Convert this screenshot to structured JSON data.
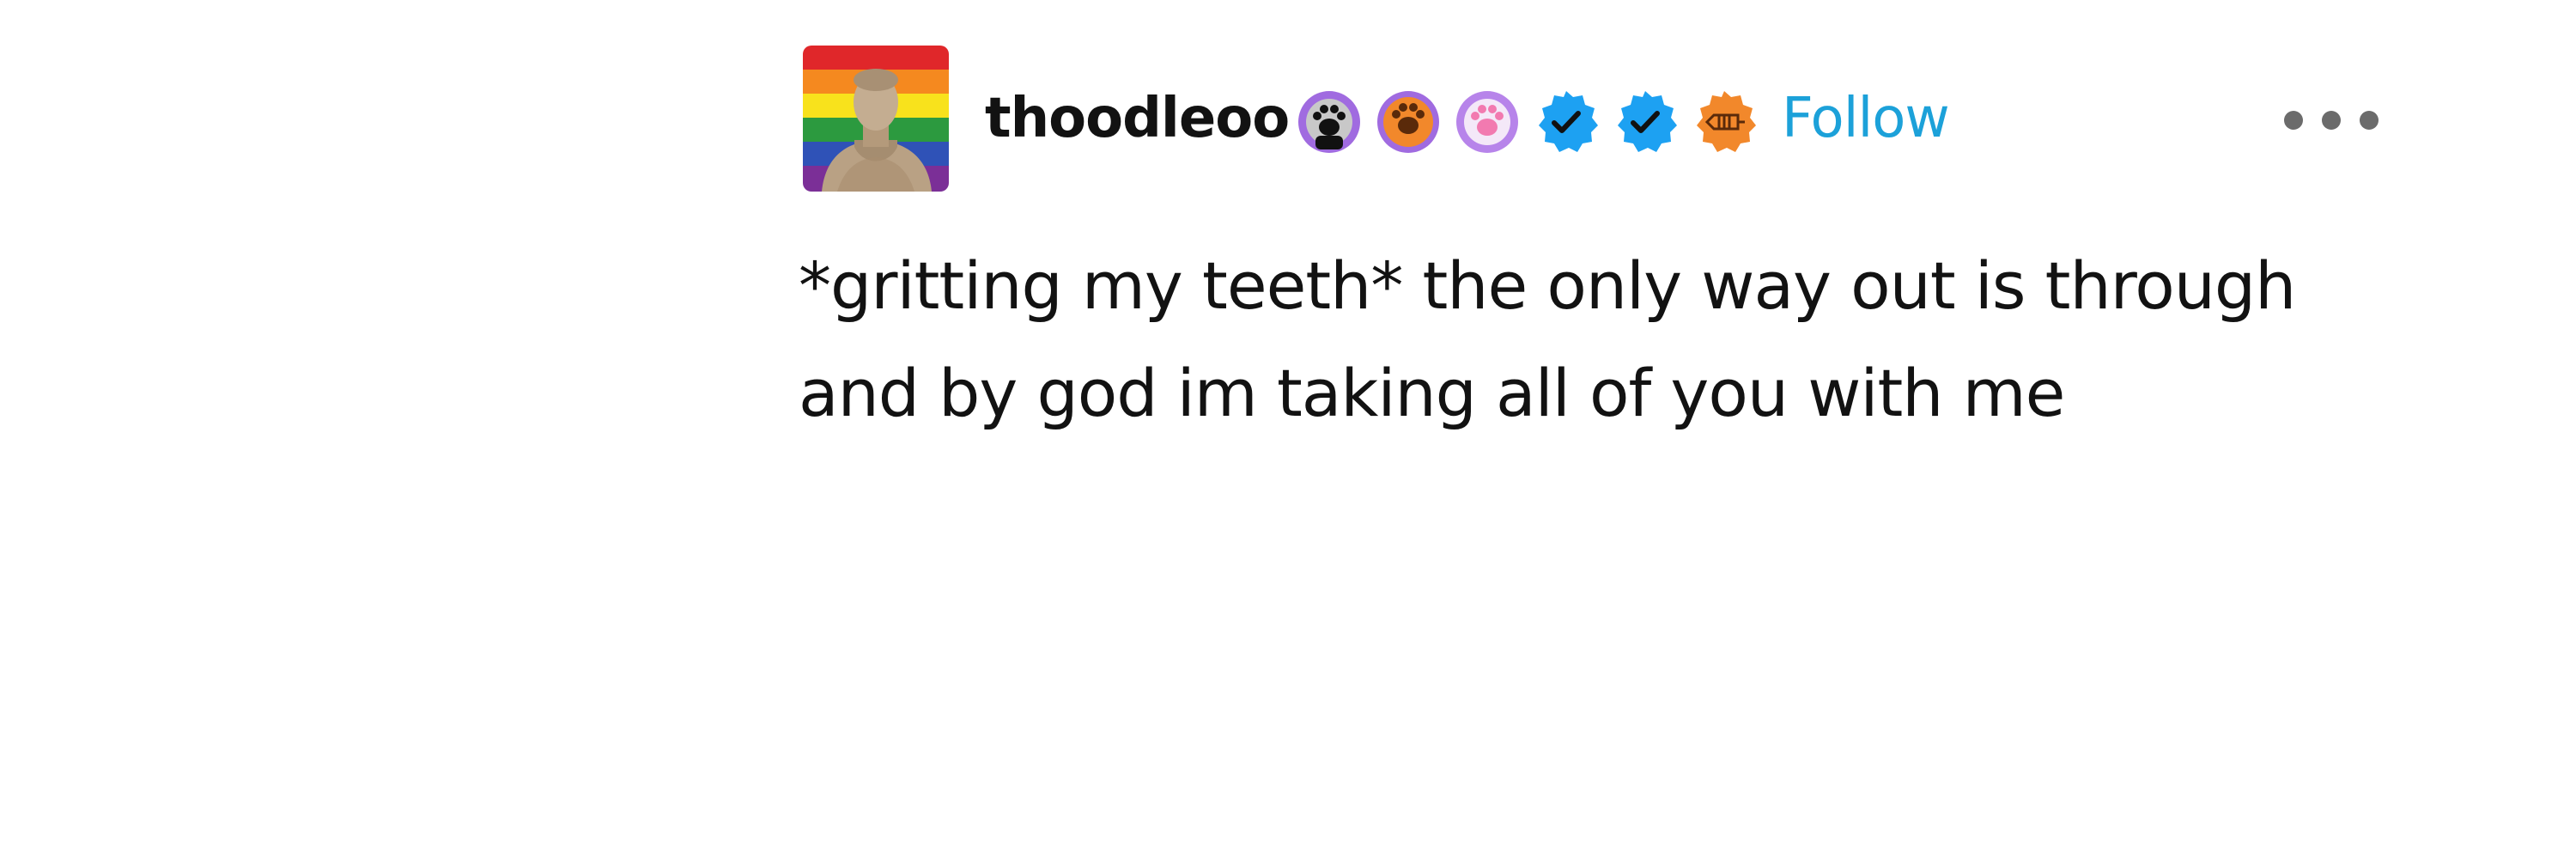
{
  "post": {
    "author": {
      "username": "thoodleoo",
      "avatar_description": "rainbow-background-bust-avatar"
    },
    "badges": [
      {
        "icon": "paw-print-icon",
        "bg": "#a06be0",
        "fg": "#111111"
      },
      {
        "icon": "paw-print-icon",
        "bg": "#f2882b",
        "fg": "#5a2a0a"
      },
      {
        "icon": "paw-print-icon",
        "bg": "#b784ea",
        "fg": "#f27ab0"
      },
      {
        "icon": "verified-check-icon",
        "bg": "#1da1f2",
        "fg": "#111111"
      },
      {
        "icon": "verified-check-icon",
        "bg": "#1da1f2",
        "fg": "#111111"
      },
      {
        "icon": "ticket-icon",
        "bg": "#f2882b",
        "fg": "#5a2a0a"
      }
    ],
    "follow_label": "Follow",
    "more_menu_icon": "ellipsis-icon",
    "body_lines": [
      "*gritting my teeth* the only way out is through",
      "and by god im taking all of you with me"
    ]
  },
  "colors": {
    "follow_link": "#1ca1d9",
    "text": "#121212",
    "background": "#ffffff"
  }
}
